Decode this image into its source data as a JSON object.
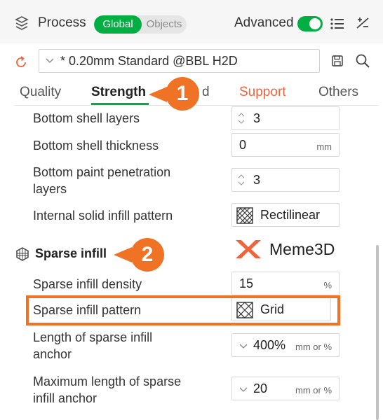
{
  "header": {
    "process_label": "Process",
    "scope_global": "Global",
    "scope_objects": "Objects",
    "advanced_label": "Advanced",
    "advanced_on": true,
    "accent_color": "#00ae42"
  },
  "preset": {
    "name": "* 0.20mm Standard @BBL H2D"
  },
  "tabs": [
    {
      "label": "Quality"
    },
    {
      "label": "Strength",
      "active": true
    },
    {
      "label": "d"
    },
    {
      "label": "Support"
    },
    {
      "label": "Others"
    }
  ],
  "rows": {
    "bottom_shell_layers": {
      "label": "Bottom shell layers",
      "value": "3"
    },
    "bottom_shell_thickness": {
      "label": "Bottom shell thickness",
      "value": "0",
      "unit": "mm"
    },
    "bottom_paint_penetration": {
      "label_line1": "Bottom paint penetration",
      "label_line2": "layers",
      "value": "3"
    },
    "internal_solid_infill_pattern": {
      "label": "Internal solid infill pattern",
      "value": "Rectilinear"
    }
  },
  "section": {
    "title": "Sparse infill",
    "rows": {
      "density": {
        "label": "Sparse infill density",
        "value": "15",
        "unit": "%"
      },
      "pattern": {
        "label": "Sparse infill pattern",
        "value": "Grid"
      },
      "anchor_length": {
        "label_line1": "Length of sparse infill",
        "label_line2": "anchor",
        "value": "400%",
        "unit": "mm or %"
      },
      "anchor_max": {
        "label_line1": "Maximum length of sparse",
        "label_line2": "infill anchor",
        "value": "20",
        "unit": "mm or %"
      }
    }
  },
  "callouts": {
    "one": "1",
    "two": "2",
    "color": "#f07224"
  },
  "watermark": {
    "text": "Meme3D"
  },
  "icons": [
    "process-icon",
    "list-icon",
    "compare-icon",
    "refresh-icon",
    "chevron-down-icon",
    "save-icon",
    "search-icon",
    "spinner-icon",
    "rectilinear-pattern-icon",
    "grid-pattern-icon",
    "sparse-infill-icon"
  ]
}
